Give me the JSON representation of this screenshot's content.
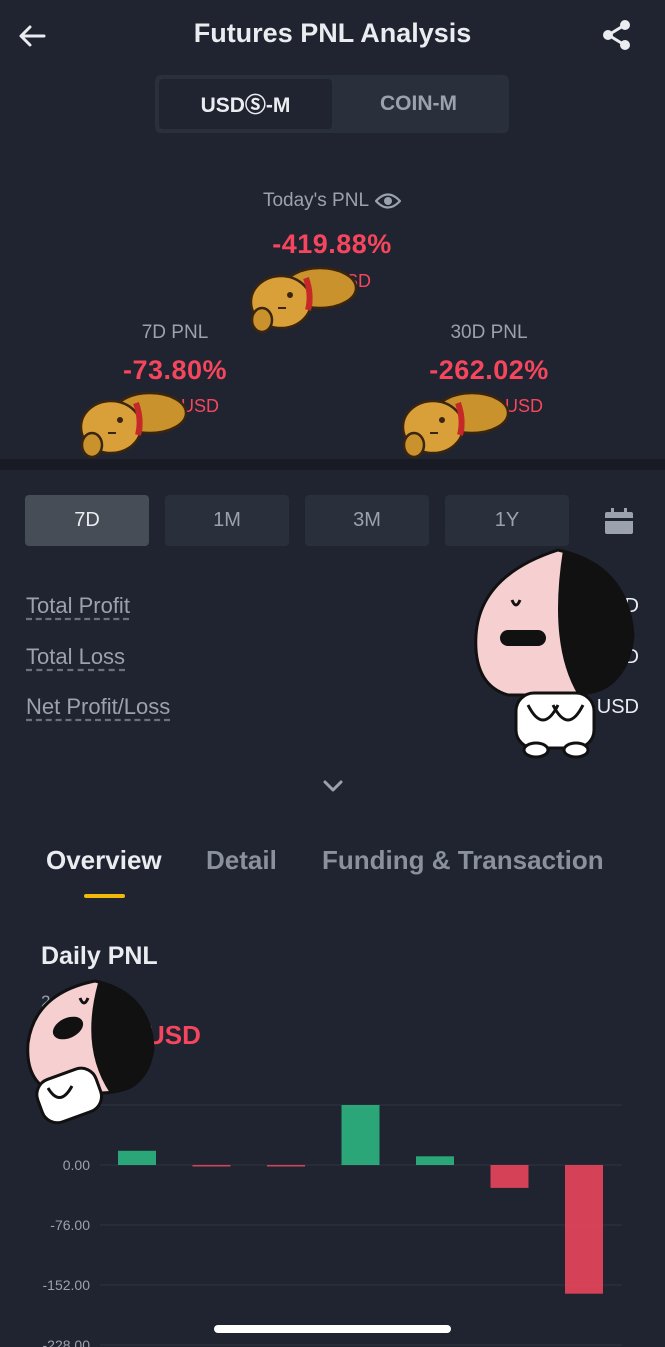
{
  "header": {
    "title": "Futures PNL Analysis",
    "back_icon": "arrow-left-icon",
    "share_icon": "share-icon"
  },
  "segment": {
    "items": [
      {
        "label": "USDⓈ-M",
        "active": true
      },
      {
        "label": "COIN-M",
        "active": false
      }
    ]
  },
  "summary": {
    "today": {
      "label": "Today's PNL",
      "value": "-419.88%",
      "unit": "USD"
    },
    "d7": {
      "label": "7D PNL",
      "value": "-73.80%",
      "unit": "USD"
    },
    "d30": {
      "label": "30D PNL",
      "value": "-262.02%",
      "unit": "USD"
    }
  },
  "periods": [
    {
      "label": "7D",
      "active": true
    },
    {
      "label": "1M",
      "active": false
    },
    {
      "label": "3M",
      "active": false
    },
    {
      "label": "1Y",
      "active": false
    }
  ],
  "stats": {
    "total_profit": {
      "label": "Total Profit",
      "value": "D"
    },
    "total_loss": {
      "label": "Total Loss",
      "value": "D"
    },
    "net": {
      "label": "Net Profit/Loss",
      "value": "USD"
    }
  },
  "section_tabs": [
    {
      "label": "Overview",
      "active": true
    },
    {
      "label": "Detail",
      "active": false
    },
    {
      "label": "Funding & Transaction",
      "active": false
    }
  ],
  "daily": {
    "title": "Daily PNL",
    "date": "2",
    "value": "USD"
  },
  "colors": {
    "positive": "#2ebd85",
    "negative": "#f6465d",
    "accent": "#f0b90b",
    "background": "#1f2430"
  },
  "chart_data": {
    "type": "bar",
    "ylim": [
      -228,
      76
    ],
    "yticks": [
      "0.00",
      "-76.00",
      "-152.00",
      "-228.00"
    ],
    "ytick_values": [
      0,
      -76,
      -152,
      -228
    ],
    "values": [
      18,
      -1,
      -1,
      76,
      11,
      -29,
      -163
    ],
    "xlabel": "",
    "ylabel": ""
  }
}
